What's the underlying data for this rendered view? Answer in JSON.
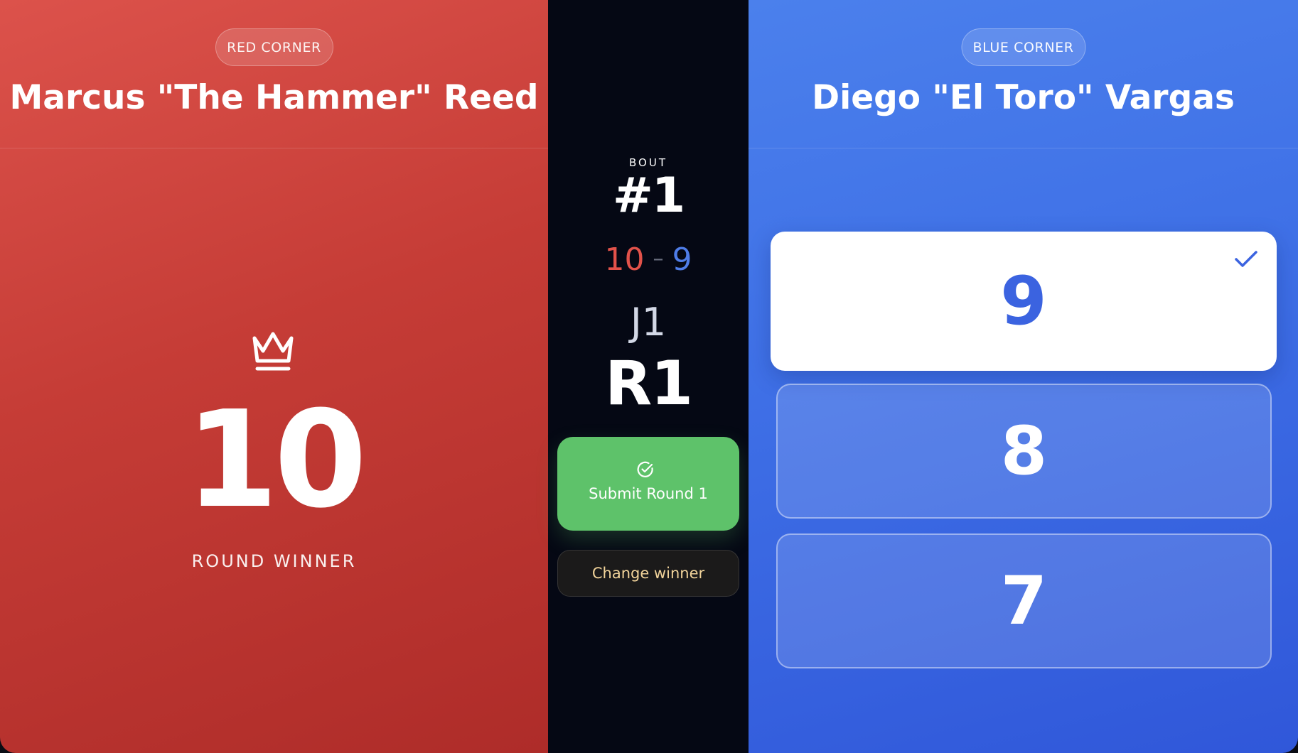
{
  "red_corner": {
    "badge": "RED CORNER",
    "fighter_name": "Marcus \"The Hammer\" Reed",
    "score": "10",
    "status_label": "ROUND WINNER",
    "color": "#c53c36"
  },
  "center": {
    "bout_label": "BOUT",
    "bout_number": "#1",
    "tally": {
      "red": "10",
      "separator": "–",
      "blue": "9"
    },
    "judge": "J1",
    "round": "R1",
    "submit_label": "Submit Round 1",
    "change_winner_label": "Change winner",
    "submit_color": "#5ec26a"
  },
  "blue_corner": {
    "badge": "BLUE CORNER",
    "fighter_name": "Diego \"El Toro\" Vargas",
    "color": "#3e6fe6",
    "score_options": [
      {
        "value": "9",
        "selected": true
      },
      {
        "value": "8",
        "selected": false
      },
      {
        "value": "7",
        "selected": false
      }
    ]
  }
}
